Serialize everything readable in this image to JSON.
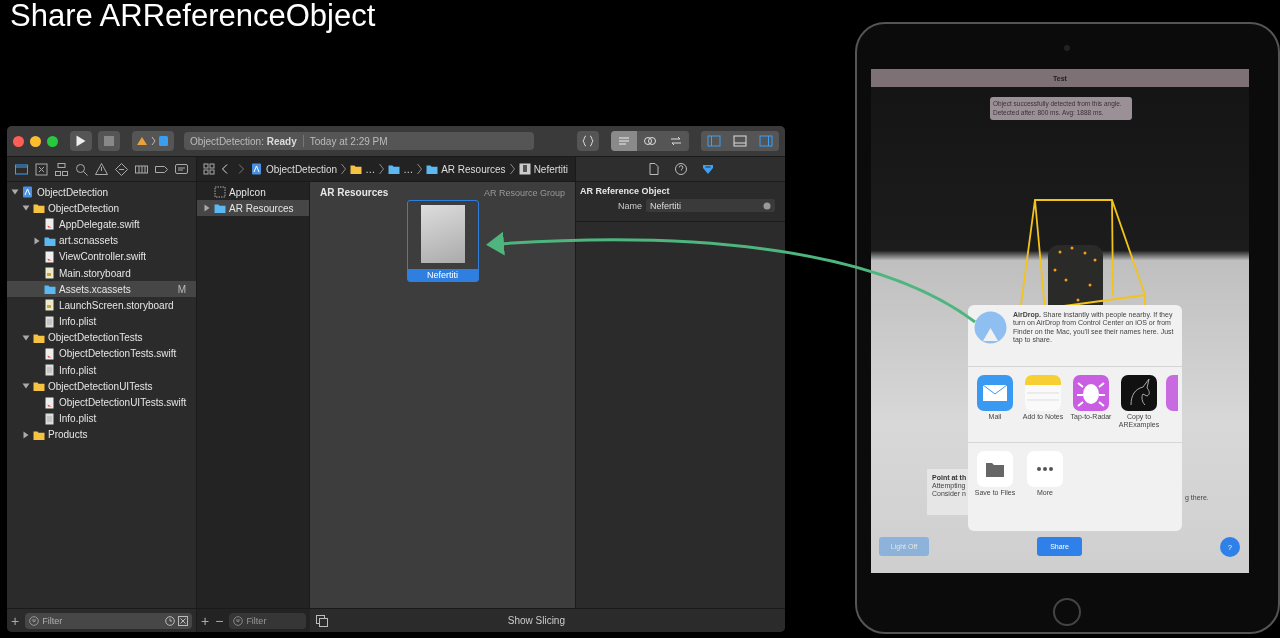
{
  "slide": {
    "title": "Share ARReferenceObject"
  },
  "xcode": {
    "toolbar": {
      "status_project": "ObjectDetection:",
      "status_state": "Ready",
      "status_time": "Today at 2:29 PM",
      "editor_modes": [
        {
          "kind": "standard",
          "selected": true
        },
        {
          "kind": "assistant",
          "selected": false
        },
        {
          "kind": "version",
          "selected": false
        }
      ],
      "panels": [
        {
          "kind": "navigator",
          "selected": true
        },
        {
          "kind": "debug",
          "selected": false
        },
        {
          "kind": "inspector",
          "selected": true
        }
      ]
    },
    "navigator_tabs": [
      {
        "kind": "project",
        "selected": true
      },
      {
        "kind": "source",
        "selected": false
      },
      {
        "kind": "symbol",
        "selected": false
      },
      {
        "kind": "find",
        "selected": false
      },
      {
        "kind": "issue",
        "selected": false
      },
      {
        "kind": "test",
        "selected": false
      },
      {
        "kind": "debug",
        "selected": false
      },
      {
        "kind": "breakpoint",
        "selected": false
      },
      {
        "kind": "report",
        "selected": false
      }
    ],
    "breadcrumb": [
      {
        "kind": "project",
        "label": "ObjectDetection"
      },
      {
        "kind": "folder",
        "label": "…"
      },
      {
        "kind": "assets",
        "label": "…"
      },
      {
        "kind": "assets",
        "label": "AR Resources"
      },
      {
        "kind": "object",
        "label": "Nefertiti"
      }
    ],
    "tree": [
      {
        "kind": "project",
        "label": "ObjectDetection",
        "expanded": true,
        "selected": false,
        "children": [
          {
            "kind": "folder",
            "label": "ObjectDetection",
            "expanded": true,
            "selected": false,
            "children": [
              {
                "kind": "swift",
                "label": "AppDelegate.swift",
                "selected": false
              },
              {
                "kind": "assets",
                "label": "art.scnassets",
                "expanded": false,
                "selected": false
              },
              {
                "kind": "swift",
                "label": "ViewController.swift",
                "selected": false
              },
              {
                "kind": "storyboard",
                "label": "Main.storyboard",
                "selected": false
              },
              {
                "kind": "assets",
                "label": "Assets.xcassets",
                "selected": true,
                "badge": "M"
              },
              {
                "kind": "storyboard",
                "label": "LaunchScreen.storyboard",
                "selected": false
              },
              {
                "kind": "plist",
                "label": "Info.plist",
                "selected": false
              }
            ]
          },
          {
            "kind": "folder",
            "label": "ObjectDetectionTests",
            "expanded": true,
            "selected": false,
            "children": [
              {
                "kind": "swift",
                "label": "ObjectDetectionTests.swift",
                "selected": false
              },
              {
                "kind": "plist",
                "label": "Info.plist",
                "selected": false
              }
            ]
          },
          {
            "kind": "folder",
            "label": "ObjectDetectionUITests",
            "expanded": true,
            "selected": false,
            "children": [
              {
                "kind": "swift",
                "label": "ObjectDetectionUITests.swift",
                "selected": false
              },
              {
                "kind": "plist",
                "label": "Info.plist",
                "selected": false
              }
            ]
          },
          {
            "kind": "folder",
            "label": "Products",
            "expanded": false,
            "selected": false
          }
        ]
      }
    ],
    "assets": [
      {
        "kind": "appicon",
        "label": "AppIcon",
        "selected": false
      },
      {
        "kind": "assets",
        "label": "AR Resources",
        "expanded": false,
        "selected": true
      }
    ],
    "editor": {
      "title": "AR Resources",
      "type_label": "AR Resource Group",
      "items": [
        {
          "label": "Nefertiti",
          "selected": true
        }
      ]
    },
    "inspector_tabs": [
      {
        "kind": "file",
        "selected": false
      },
      {
        "kind": "help",
        "selected": false
      },
      {
        "kind": "attributes",
        "selected": true
      }
    ],
    "inspector": {
      "section": "AR Reference Object",
      "field_label": "Name",
      "field_value": "Nefertiti"
    },
    "footer": {
      "nav_add": "+",
      "nav_filter_placeholder": "Filter",
      "list_add": "+",
      "list_remove": "−",
      "list_filter_placeholder": "Filter",
      "slicing_label": "Show Slicing"
    }
  },
  "ipad": {
    "nav_title": "Test",
    "status_lines": [
      "Object successfully detected from this angle.",
      "Detected after: 800 ms. Avg: 1888 ms."
    ],
    "hint": {
      "title": "Point at th",
      "lines": [
        "Attempting",
        "Consider n"
      ],
      "tail": "g there."
    },
    "share_sheet": {
      "airdrop": "**AirDrop.** Share instantly with people nearby. If they turn on AirDrop from Control Center on iOS or from Finder on the Mac, you'll see their names here. Just tap to share.",
      "apps": [
        {
          "kind": "mail",
          "label": "Mail"
        },
        {
          "kind": "notes",
          "label": "Add to Notes"
        },
        {
          "kind": "radar",
          "label": "Tap-to-Radar"
        },
        {
          "kind": "unicorn",
          "label": "Copy to ARExamples"
        }
      ],
      "actions": [
        {
          "kind": "files",
          "label": "Save to Files"
        },
        {
          "kind": "more",
          "label": "More"
        }
      ]
    },
    "buttons": [
      {
        "kind": "light",
        "label": "Light Off",
        "disabled": true
      },
      {
        "kind": "share",
        "label": "Share",
        "disabled": false
      },
      {
        "kind": "help",
        "label": "?",
        "disabled": false
      }
    ]
  }
}
